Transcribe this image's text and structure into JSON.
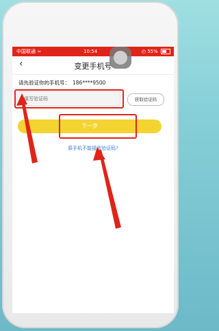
{
  "status_bar": {
    "carrier": "中国联通",
    "wifi_icon": "wifi-icon",
    "time": "10:54",
    "battery": "55%"
  },
  "nav": {
    "back_icon": "chevron-left-icon",
    "title": "变更手机号"
  },
  "verify": {
    "hint": "请先验证你的手机号：",
    "phone": "186****9500",
    "code_placeholder": "填写验证码",
    "get_code_label": "获取验证码",
    "next_label": "下一步",
    "cant_receive_label": "原手机不能接收验证码?"
  },
  "colors": {
    "status_red": "#e0241a",
    "accent_yellow": "#f3d431",
    "link_blue": "#3a7fd0",
    "annotation_red": "#e0241a"
  }
}
